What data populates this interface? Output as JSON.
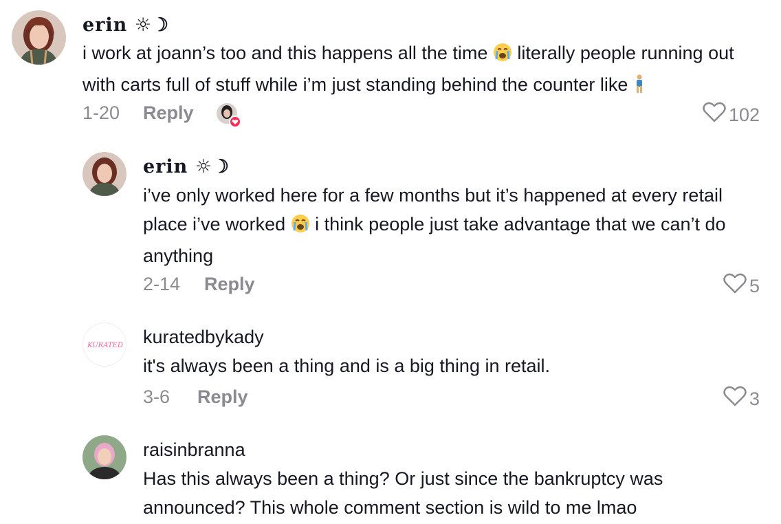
{
  "comments": [
    {
      "username": "erin ☼☽",
      "text_part1": "i work at joann’s too and this happens all the time",
      "text_part2": "literally people running out with carts full of stuff while i’m just standing behind the counter like",
      "date": "1-20",
      "reply_label": "Reply",
      "likes": "102",
      "emoji1": "loudly-crying-face",
      "emoji2": "standing-person"
    },
    {
      "username": "erin ☼☽",
      "text_part1": "i’ve only worked here for a few months but it’s happened at every retail place i’ve worked",
      "text_part2": "i think people just take advantage that we can’t do anything",
      "date": "2-14",
      "reply_label": "Reply",
      "likes": "5",
      "emoji1": "loudly-crying-face"
    },
    {
      "username": "kuratedbykady",
      "text": "it's always been a thing and is a big thing in retail.",
      "date": "3-6",
      "reply_label": "Reply",
      "likes": "3",
      "avatar_logo_text": "KURATED"
    },
    {
      "username": "raisinbranna",
      "text": "Has this always been a thing? Or just since the bankruptcy was announced? This whole comment section is wild to me lmao"
    }
  ],
  "colors": {
    "text": "#161823",
    "muted": "#8a8b91",
    "like_heart_badge": "#fe2c55",
    "kurated_logo": "#f06292"
  }
}
